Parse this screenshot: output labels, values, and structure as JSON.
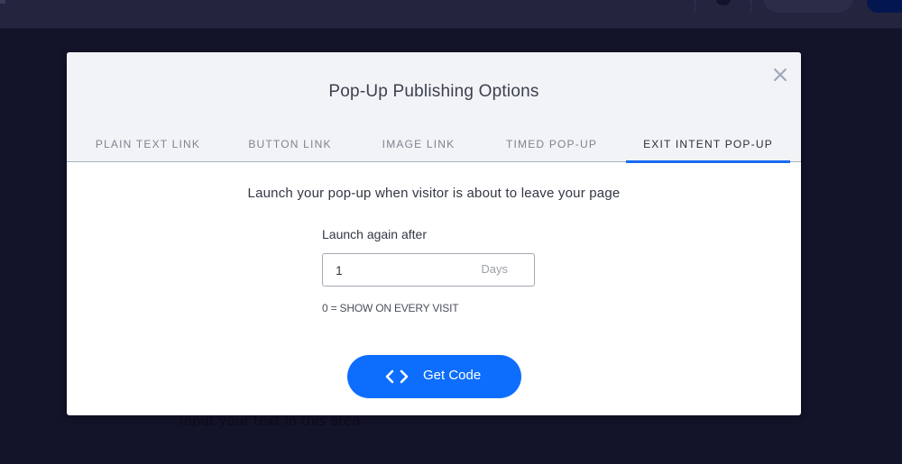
{
  "background": {
    "hint_text": "Input your text in this area"
  },
  "modal": {
    "title": "Pop-Up Publishing Options",
    "close_icon": "close-icon",
    "tabs": [
      {
        "label": "PLAIN TEXT LINK",
        "active": false
      },
      {
        "label": "BUTTON LINK",
        "active": false
      },
      {
        "label": "IMAGE LINK",
        "active": false
      },
      {
        "label": "TIMED POP-UP",
        "active": false
      },
      {
        "label": "EXIT INTENT POP-UP",
        "active": true
      }
    ],
    "description": "Launch your pop-up when visitor is about to leave your page",
    "launch_again": {
      "label": "Launch again after",
      "value": "1",
      "unit": "Days"
    },
    "hint": "0 = SHOW ON EVERY VISIT",
    "get_code_button": {
      "label": "Get Code",
      "icon": "code-icon"
    }
  },
  "colors": {
    "accent": "#0d6efd",
    "active_tab_underline": "#1a6cf0",
    "header_bg": "#f2f3f7",
    "overlay_bg": "#131329"
  }
}
